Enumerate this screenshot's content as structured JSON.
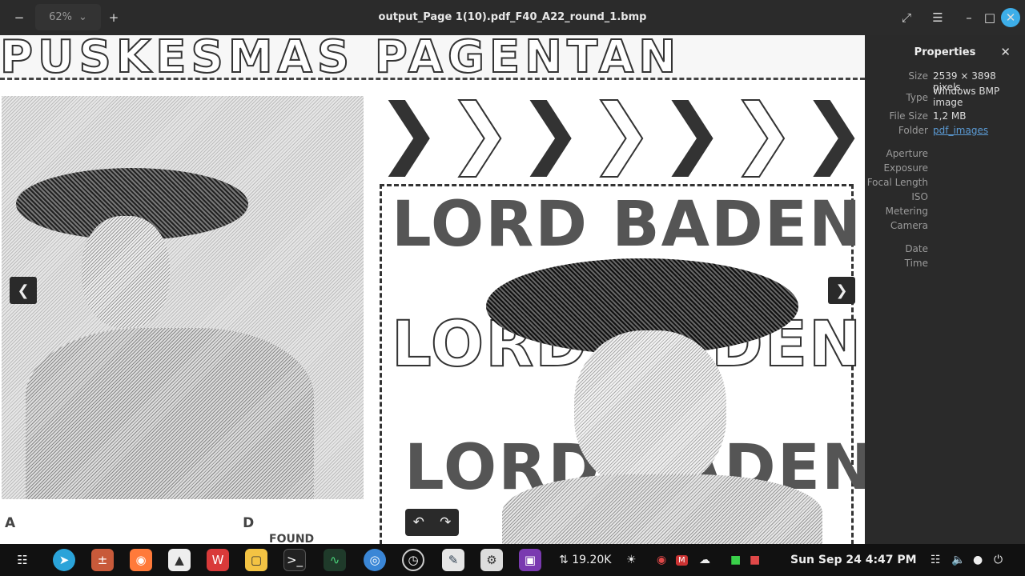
{
  "titlebar": {
    "zoom": "62%",
    "title": "output_Page 1(10).pdf_F40_A22_round_1.bmp"
  },
  "image_text": {
    "banner": "PUSKESMAS PAGENTAN",
    "lord_1": "LORD BADEN",
    "lord_2": "LORD BADEN",
    "lord_3": "LORD BADEN",
    "footer_letter_a": "A",
    "footer_letter_d": "D",
    "footer_fragment": "FOUND IT"
  },
  "properties": {
    "heading": "Properties",
    "rows": [
      {
        "key": "Size",
        "value": "2539 × 3898 pixels"
      },
      {
        "key": "Type",
        "value": "Windows BMP image"
      },
      {
        "key": "File Size",
        "value": "1,2 MB"
      },
      {
        "key": "Folder",
        "value": "pdf_images"
      },
      {
        "key": "Aperture",
        "value": ""
      },
      {
        "key": "Exposure",
        "value": ""
      },
      {
        "key": "Focal Length",
        "value": ""
      },
      {
        "key": "ISO",
        "value": ""
      },
      {
        "key": "Metering",
        "value": ""
      },
      {
        "key": "Camera",
        "value": ""
      },
      {
        "key": "Date",
        "value": ""
      },
      {
        "key": "Time",
        "value": ""
      }
    ]
  },
  "taskbar": {
    "network_speed": "19.20K",
    "clock": "Sun Sep 24  4:47 PM"
  },
  "colors": {
    "titlebar": "#2b2b2b",
    "panel": "#2a2a2a",
    "link": "#5b9bd5",
    "taskbar": "#111111"
  }
}
